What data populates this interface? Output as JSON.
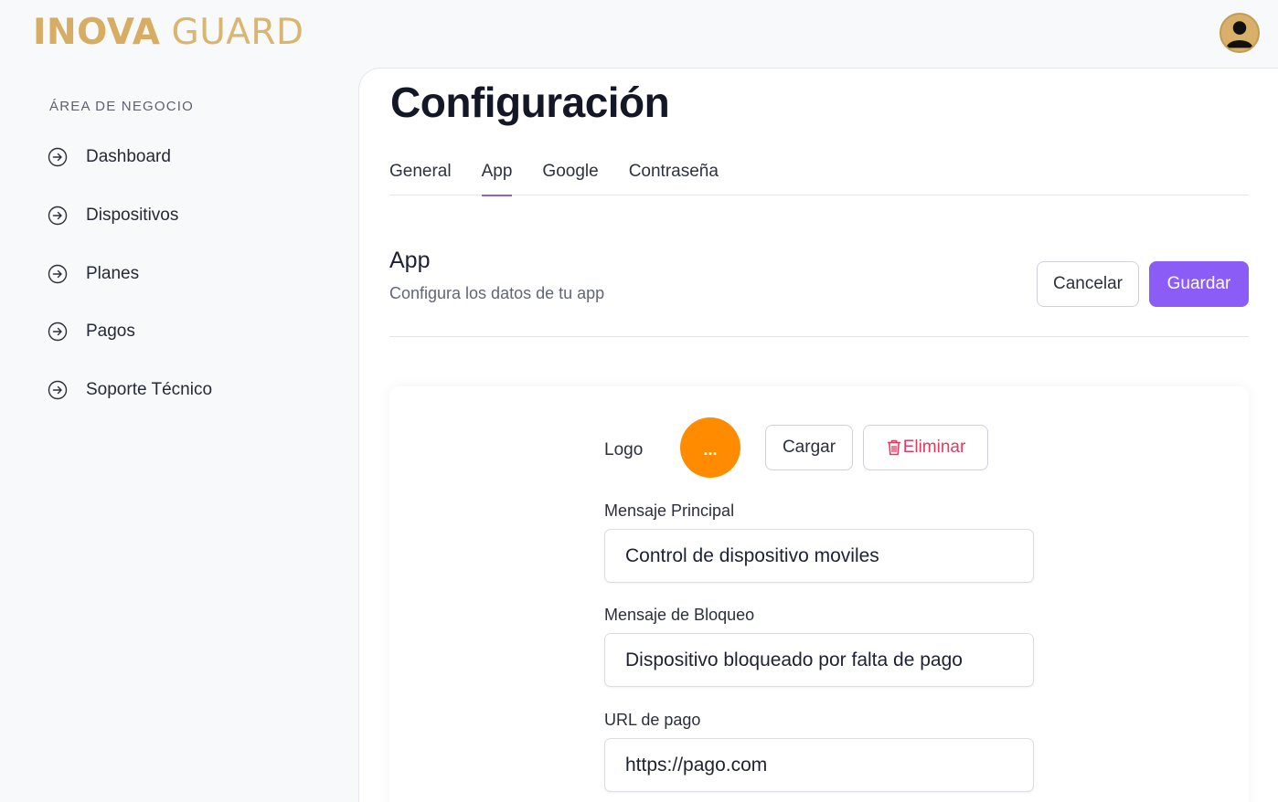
{
  "brand": {
    "name_bold": "INOVA",
    "name_light": "GUARD",
    "color": "#d7ad63"
  },
  "user": {
    "avatar_icon": "user-avatar-icon"
  },
  "sidebar": {
    "section_title": "ÁREA DE NEGOCIO",
    "items": [
      {
        "label": "Dashboard",
        "icon": "arrow-circle-right-icon"
      },
      {
        "label": "Dispositivos",
        "icon": "arrow-circle-right-icon"
      },
      {
        "label": "Planes",
        "icon": "arrow-circle-right-icon"
      },
      {
        "label": "Pagos",
        "icon": "arrow-circle-right-icon"
      },
      {
        "label": "Soporte Técnico",
        "icon": "arrow-circle-right-icon"
      }
    ]
  },
  "main": {
    "title": "Configuración",
    "tabs": [
      {
        "label": "General",
        "active": false
      },
      {
        "label": "App",
        "active": true
      },
      {
        "label": "Google",
        "active": false
      },
      {
        "label": "Contraseña",
        "active": false
      }
    ],
    "section": {
      "title": "App",
      "subtitle": "Configura los datos de tu app"
    },
    "actions": {
      "cancel": "Cancelar",
      "save": "Guardar"
    },
    "accent_color": "#8b5cf6",
    "logo": {
      "label": "Logo",
      "placeholder_text": "...",
      "color": "#ff8c00",
      "load": "Cargar",
      "delete": "Eliminar",
      "delete_color": "#e23b5f"
    },
    "fields": [
      {
        "label": "Mensaje Principal",
        "value": "Control de dispositivo moviles"
      },
      {
        "label": "Mensaje de Bloqueo",
        "value": "Dispositivo bloqueado por falta de pago"
      },
      {
        "label": "URL de pago",
        "value": "https://pago.com"
      }
    ]
  }
}
